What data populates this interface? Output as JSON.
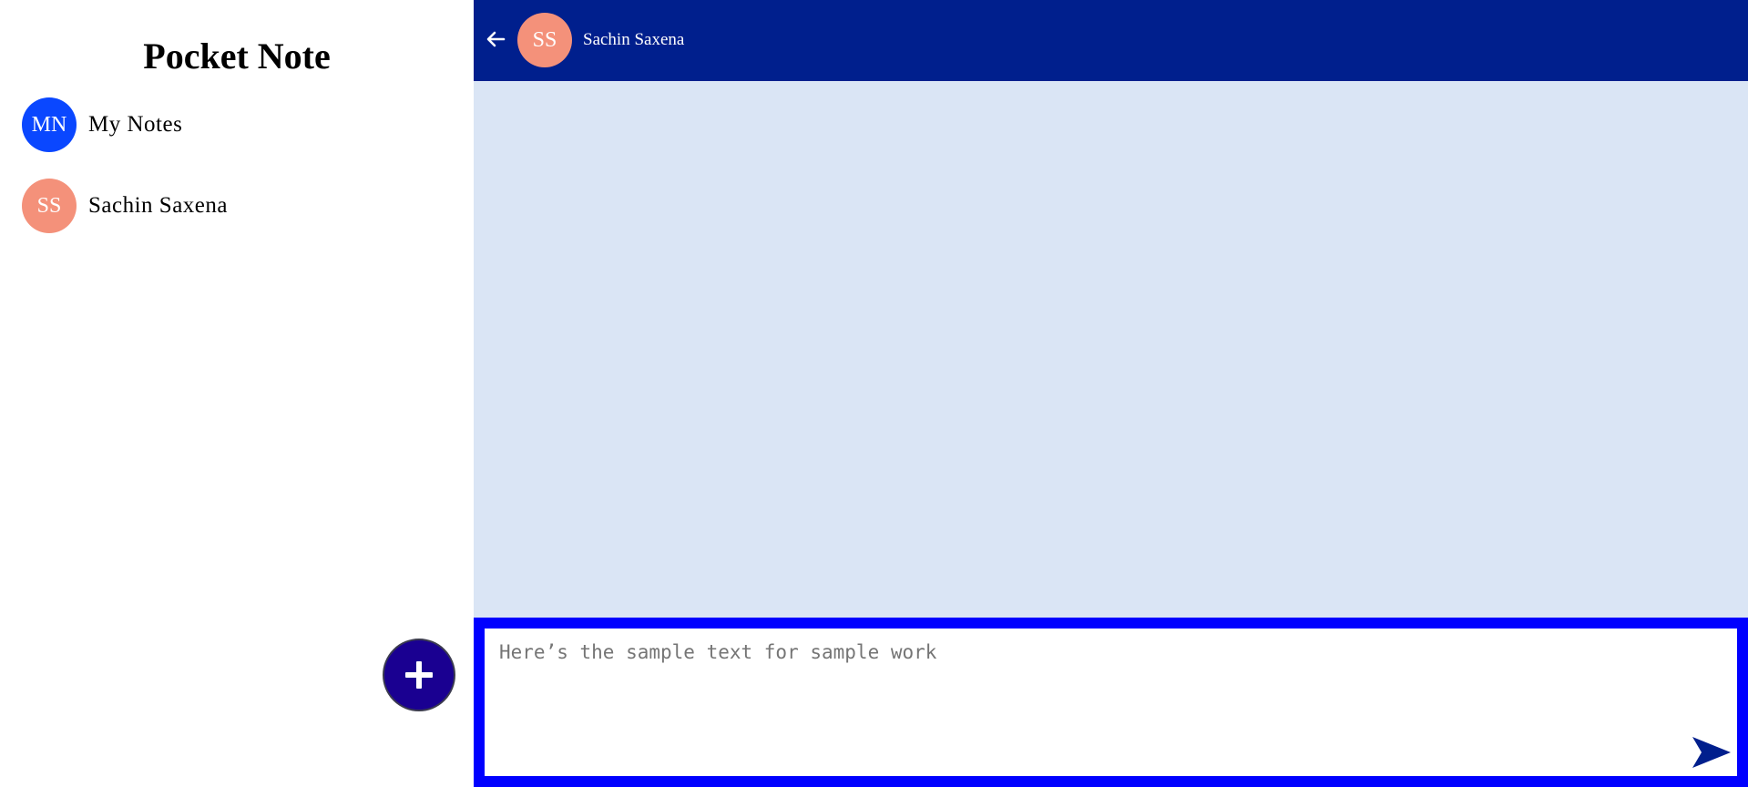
{
  "sidebar": {
    "title": "Pocket Note",
    "groups": [
      {
        "initials": "MN",
        "name": "My Notes",
        "color": "#0a47ff"
      },
      {
        "initials": "SS",
        "name": "Sachin Saxena",
        "color": "#f4917a"
      }
    ],
    "add_button_icon": "plus-icon",
    "add_button_color": "#1a0091"
  },
  "chat": {
    "back_icon": "arrow-left-icon",
    "header": {
      "initials": "SS",
      "name": "Sachin Saxena",
      "avatar_color": "#f4917a",
      "background": "#001f8d"
    },
    "background": "#dae5f5",
    "composer": {
      "placeholder": "Here’s the sample text for sample work",
      "border_color": "#0000ff",
      "send_icon": "send-icon"
    }
  }
}
